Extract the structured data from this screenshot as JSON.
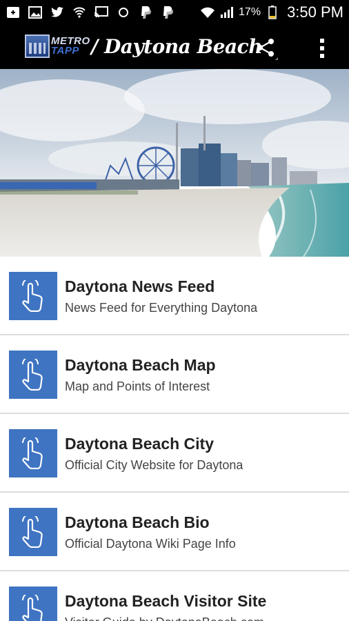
{
  "status_bar": {
    "icons": [
      "add-box-icon",
      "image-icon",
      "twitter-icon",
      "signal-icon",
      "cast-icon",
      "sync-icon",
      "paypal-icon",
      "paypal-icon",
      "wifi-icon",
      "cell-signal-icon",
      "battery-icon"
    ],
    "battery": "17%",
    "time": "3:50 PM"
  },
  "app_bar": {
    "logo_line1": "METRO",
    "logo_line2": "TAPP",
    "title": "/ Daytona Beach",
    "share_icon": "share-icon",
    "more_icon": "more-vert-icon"
  },
  "hero": {
    "description_icon": "beach-image"
  },
  "list": {
    "items": [
      {
        "title": "Daytona News Feed",
        "subtitle": "News Feed for Everything Daytona",
        "icon": "tap-hand-icon"
      },
      {
        "title": "Daytona Beach Map",
        "subtitle": "Map and Points of Interest",
        "icon": "tap-hand-icon"
      },
      {
        "title": "Daytona Beach City",
        "subtitle": "Official City Website for Daytona",
        "icon": "tap-hand-icon"
      },
      {
        "title": "Daytona Beach Bio",
        "subtitle": "Official Daytona Wiki Page Info",
        "icon": "tap-hand-icon"
      },
      {
        "title": "Daytona Beach Visitor Site",
        "subtitle": "Visitor Guide by DaytonaBeach.com",
        "icon": "tap-hand-icon"
      }
    ]
  },
  "colors": {
    "accent_blue": "#3f74c2",
    "bar_black": "#000000"
  }
}
